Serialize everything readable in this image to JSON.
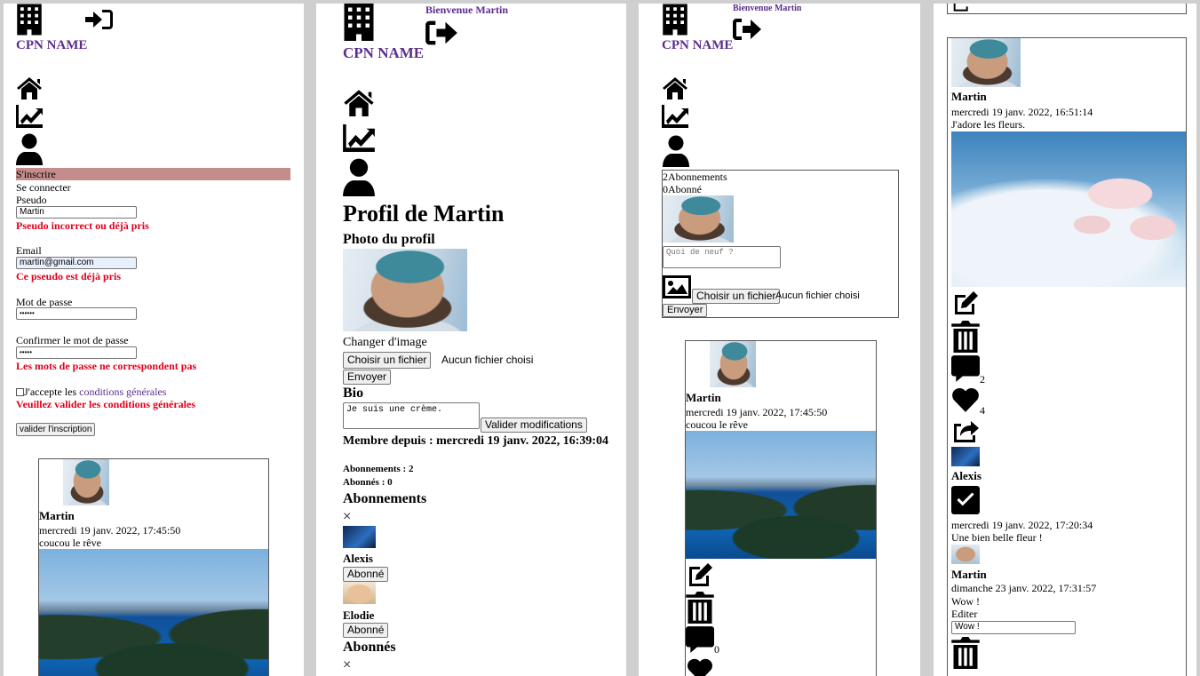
{
  "header": {
    "brand": "CPN NAME",
    "welcome": "Bienvenue Martin"
  },
  "signup": {
    "tab_register": "S'inscrire",
    "tab_login": "Se connecter",
    "pseudo_label": "Pseudo",
    "pseudo_value": "Martin",
    "pseudo_error": "Pseudo incorrect ou déjà pris",
    "email_label": "Email",
    "email_value": "martin@gmail.com",
    "email_error": "Ce pseudo est déjà pris",
    "password_label": "Mot de passe",
    "password_value": "••••••",
    "confirm_label": "Confirmer le mot de passe",
    "confirm_value": "•••••",
    "confirm_error": "Les mots de passe ne correspondent pas",
    "accept_prefix": "J'accepte les ",
    "accept_link": "conditions générales",
    "accept_error": "Veuillez valider les conditions générales",
    "submit": "valider l'inscription"
  },
  "profile": {
    "title": "Profil de Martin",
    "photo_heading": "Photo du profil",
    "change_image": "Changer d'image",
    "choose_file": "Choisir un fichier",
    "no_file": "Aucun fichier choisi",
    "send": "Envoyer",
    "bio_heading": "Bio",
    "bio_value": "Je suis une crème.",
    "save_bio": "Valider modifications",
    "member_since": "Membre depuis : mercredi 19 janv. 2022, 16:39:04",
    "subscriptions_count": "Abonnements : 2",
    "followers_count": "Abonnés : 0",
    "subscriptions_heading": "Abonnements",
    "close_glyph": "×",
    "subscriptions": [
      {
        "name": "Alexis",
        "button": "Abonné"
      },
      {
        "name": "Elodie",
        "button": "Abonné"
      }
    ],
    "followers_heading": "Abonnés"
  },
  "feed": {
    "subs_line": "2Abonnements",
    "followers_line": "0Abonné",
    "post_placeholder": "Quoi de neuf ?",
    "choose_file": "Choisir un fichier",
    "no_file": "Aucun fichier choisi",
    "send": "Envoyer"
  },
  "post1": {
    "author": "Martin",
    "date": "mercredi 19 janv. 2022, 17:45:50",
    "text": "coucou le rêve",
    "comment_count": "0"
  },
  "post2": {
    "author": "Martin",
    "date": "mercredi 19 janv. 2022, 16:51:14",
    "text": "J'adore les fleurs.",
    "comment_count": "2",
    "like_count": "4",
    "comments": [
      {
        "author": "Alexis",
        "date": "mercredi 19 janv. 2022, 17:20:34",
        "text": "Une bien belle fleur !"
      },
      {
        "author": "Martin",
        "date": "dimanche 23 janv. 2022, 17:31:57",
        "text": "Wow !",
        "edit_label": "Editer",
        "edit_value": "Wow !"
      }
    ]
  }
}
